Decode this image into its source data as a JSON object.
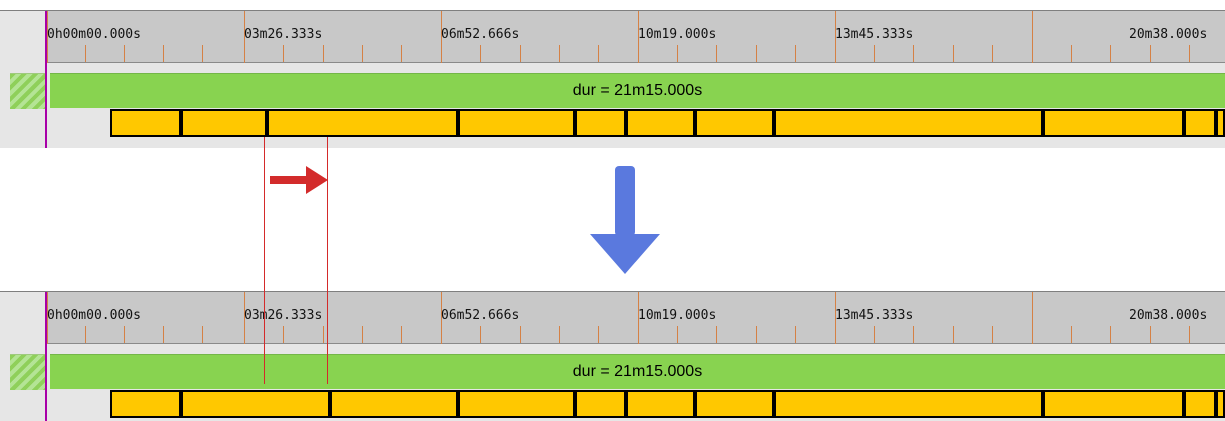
{
  "window": {
    "title": ""
  },
  "timeline_top": {
    "ruler_labels": [
      "0h00m00.000s",
      "03m26.333s",
      "06m52.666s",
      "10m19.000s",
      "13m45.333s",
      "20m38.000s"
    ],
    "duration_label": "dur = 21m15.000s"
  },
  "timeline_bottom": {
    "ruler_labels": [
      "0h00m00.000s",
      "03m26.333s",
      "06m52.666s",
      "10m19.000s",
      "13m45.333s",
      "20m38.000s"
    ],
    "duration_label": "dur = 21m15.000s"
  },
  "colors": {
    "ruler_bg": "#c8c8c8",
    "tick": "#d58145",
    "duration_bar": "#88d350",
    "segment_fill": "#ffc800",
    "segment_border": "#000000",
    "guide_line": "#d42a2a",
    "transition_arrow": "#5a79de",
    "playhead": "#a800a8"
  },
  "icons": {
    "move_arrow": "red-right-arrow-icon",
    "transition_arrow": "blue-down-arrow-icon",
    "stripe": "striped-icon"
  }
}
